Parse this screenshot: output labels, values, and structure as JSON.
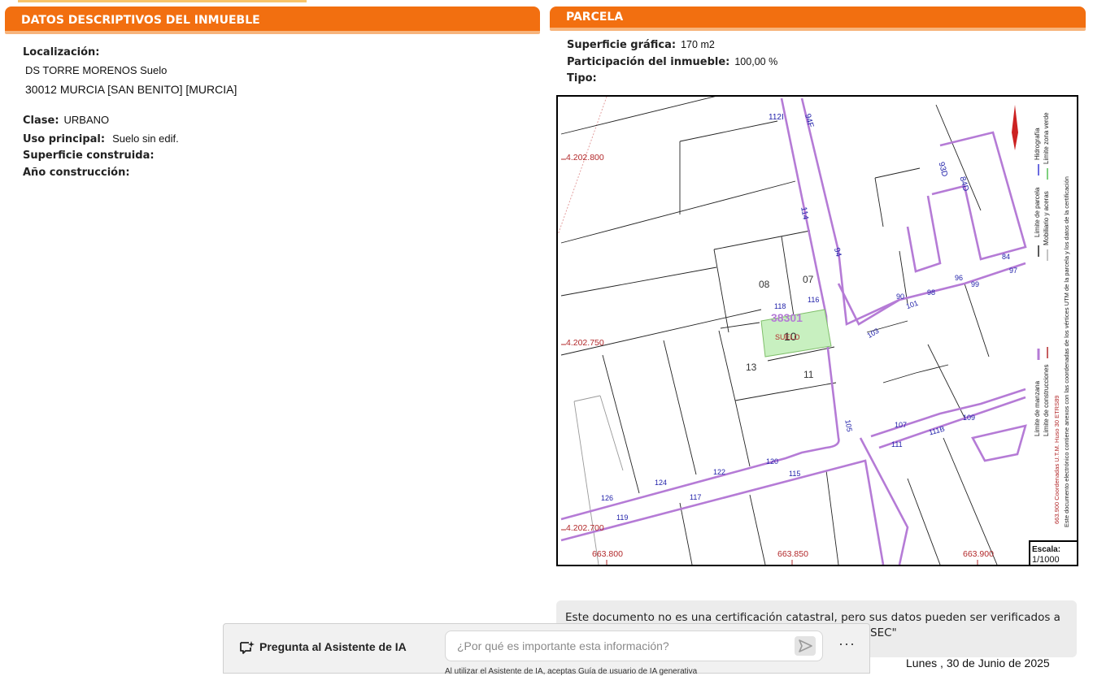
{
  "left_panel": {
    "title": "DATOS DESCRIPTIVOS DEL INMUEBLE",
    "localizacion_label": "Localización:",
    "address_line1": "DS TORRE MORENOS  Suelo",
    "address_line2": "30012 MURCIA [SAN BENITO] [MURCIA]",
    "clase_label": "Clase:",
    "clase_value": "URBANO",
    "uso_label": "Uso principal:",
    "uso_value": "Suelo sin edif.",
    "superficie_construida_label": "Superficie construida:",
    "ano_label": "Año construcción:"
  },
  "right_panel": {
    "title": "PARCELA",
    "superficie_grafica_label": "Superficie gráfica:",
    "superficie_grafica_value": "170 m2",
    "participacion_label": "Participación del inmueble:",
    "participacion_value": "100,00 %",
    "tipo_label": "Tipo:"
  },
  "map": {
    "coord_labels": {
      "y1": "4.202.800",
      "y2": "4.202.750",
      "y3": "4.202.700",
      "x1": "663.800",
      "x2": "663.850",
      "x3": "663.900"
    },
    "parcel_ref": "38301",
    "parcel_number": "10",
    "parcel_use": "SUELO",
    "parcel_numbers": [
      "08",
      "07",
      "13",
      "11"
    ],
    "street_numbers": [
      "112I",
      "94F",
      "114",
      "94",
      "118",
      "116",
      "93D",
      "84D",
      "84",
      "97",
      "96",
      "99",
      "98",
      "90",
      "101",
      "103",
      "105",
      "107",
      "111B",
      "109",
      "111",
      "120",
      "115",
      "122",
      "124",
      "126",
      "117",
      "119"
    ],
    "colors": {
      "street_boundary": "#b57bd6",
      "parcel_highlight": "#c8f0c0",
      "coordinates": "#b2282a",
      "numbers": "#2222aa"
    }
  },
  "legend": {
    "items": [
      "Límite de manzana",
      "Límite de construcciones",
      "Límite de parcela",
      "Mobiliario y aceras",
      "Hidrografía",
      "Límite zona verde"
    ],
    "coords_note": "663.900 Coordenadas U.T.M. Huso 30 ETRS89",
    "document_note": "Este documento electrónico contiene anexos con las coordenadas de los vértices UTM de la parcela y los datos de la certificación",
    "scale_label": "Escala:",
    "scale_value": "1/1000"
  },
  "notice": {
    "line1": "Este documento no es una certificación catastral, pero sus datos pueden ser verificados a",
    "line2": "SEC\""
  },
  "date": "Lunes , 30 de Junio de 2025",
  "ai_assistant": {
    "title": "Pregunta al Asistente de IA",
    "placeholder": "¿Por qué es importante esta información?",
    "more_label": "···",
    "disclaimer": "Al utilizar el Asistente de IA, aceptas Guía de usuario de IA generativa"
  }
}
